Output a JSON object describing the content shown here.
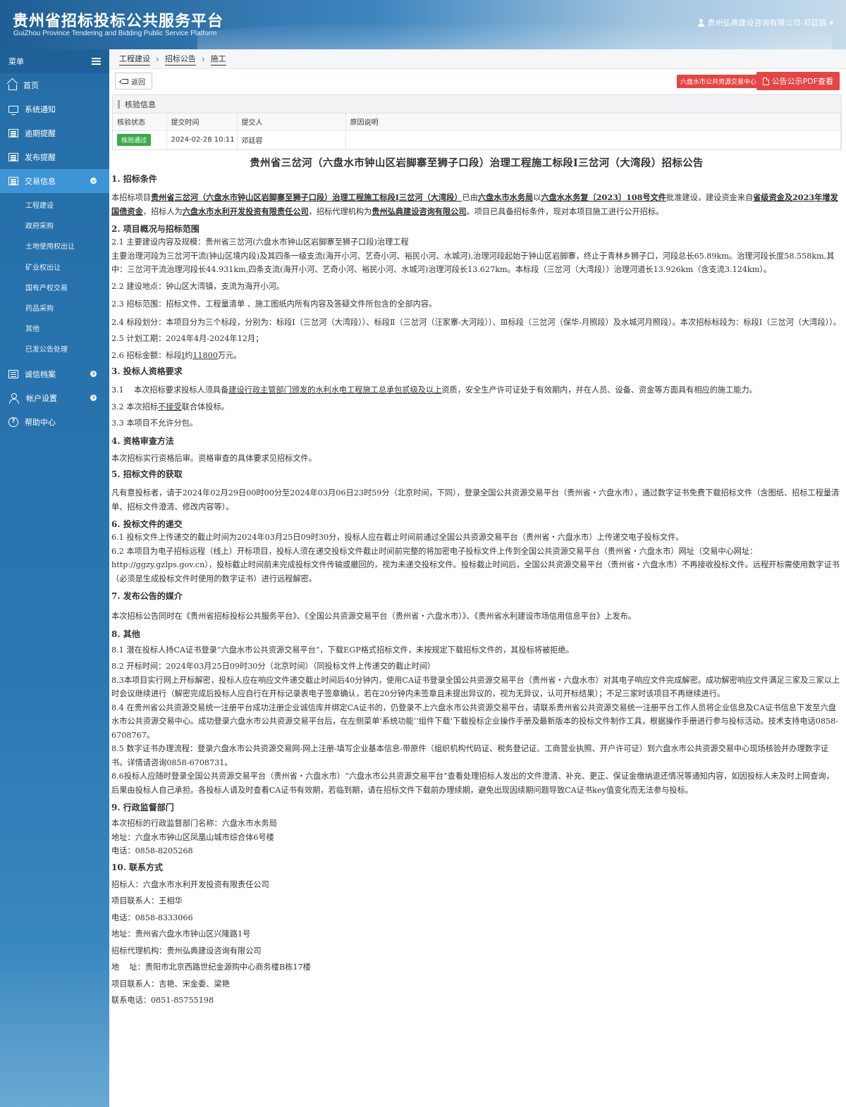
{
  "header": {
    "title": "贵州省招标投标公共服务平台",
    "subtitle": "GuiZhou Province Tendering and Bidding Public Service Platform",
    "user": "贵州弘典建设咨询有限公司-邓廷容",
    "user_caret": "▾"
  },
  "sidebar": {
    "menu_label": "菜单",
    "items": [
      {
        "label": "首页"
      },
      {
        "label": "系统通知"
      },
      {
        "label": "逾期提醒"
      },
      {
        "label": "发布提醒"
      },
      {
        "label": "交易信息"
      },
      {
        "label": "诚信档案"
      },
      {
        "label": "帐户设置"
      },
      {
        "label": "帮助中心"
      }
    ],
    "help_glyph": "?",
    "sub_items": [
      "工程建设",
      "政府采购",
      "土地使用权出让",
      "矿业权出让",
      "国有产权交易",
      "药品采购",
      "其他",
      "已发公告处理"
    ]
  },
  "breadcrumb": {
    "items": [
      "工程建设",
      "招标公告",
      "施工"
    ],
    "sep": "›"
  },
  "toolbar": {
    "back_label": "返回",
    "center_tag": "六盘水市公共资源交易中心",
    "pdf_label": "公告公示PDF查看"
  },
  "verify": {
    "title": "核验信息",
    "headers": [
      "核验状态",
      "提交时间",
      "提交人",
      "原因说明"
    ],
    "status": "核验通过",
    "time": "2024-02-28 10:11",
    "person": "邓廷容",
    "reason": ""
  },
  "article": {
    "title": "贵州省三岔河（六盘水市钟山区岩脚寨至狮子口段）治理工程施工标段Ⅰ三岔河（大湾段）招标公告",
    "s1": "1. 招标条件",
    "s1_p": {
      "t1": "本招标项目",
      "b1": "贵州省三岔河（六盘水市钟山区岩脚寨至狮子口段）治理工程施工标段Ⅰ三岔河（大湾段）",
      "t2": "已由",
      "b2": "六盘水市水务局",
      "t3": "以",
      "b3": "六盘水水务复〔2023〕108号文件",
      "t4": "批准建设，建设资金来自",
      "b4": "省级资金及2023年增发国债资金",
      "t5": "，招标人为",
      "b5": "六盘水市水利开发投资有限责任公司",
      "t6": "，招标代理机构为",
      "b6": "贵州弘典建设咨询有限公司",
      "t7": "。项目已具备招标条件，现对本项目施工进行公开招标。"
    },
    "s2": "2. 项目概况与招标范围",
    "p2_1": "2.1 主要建设内容及规模：贵州省三岔河(六盘水市钟山区岩脚寨至狮子口段)治理工程",
    "p2_1b": "主要治理河段为三岔河干流(钟山区境内段)及其四条一级支流(海开小河、艺奇小河、裕民小河、水城河),治理河段起始于钟山区岩脚寨，终止于青林乡狮子口，河段总长65.89km。治理河段长度58.558km,其中：三岔河干流治理河段长44.931km,四条支流(海开小河、艺奇小河、裕民小河、水城河)治理河段长13.627km。本标段（三岔河（大湾段））治理河道长13.926km（含支流3.124km）。",
    "p2_2": "2.2 建设地点：钟山区大湾镇，支流为海开小河。",
    "p2_3": "2.3 招标范围：招标文件、工程量清单 、施工图纸内所有内容及答疑文件所包含的全部内容。",
    "p2_4": "2.4 标段划分：本项目分为三个标段，分别为：标段Ⅰ（三岔河（大湾段））、标段Ⅱ（三岔河（汪家寨-大河段））、Ⅲ标段（三岔河（保华-月照段）及水城河月照段）。本次招标标段为：标段Ⅰ（三岔河（大湾段））。",
    "p2_5": "2.5 计划工期：2024年4月-2024年12月；",
    "p2_6": {
      "t1": "2.6 招标金额：标段",
      "u1": "Ⅰ",
      "t2": "约",
      "u2": "11800",
      "t3": "万元。"
    },
    "s3": "3. 投标人资格要求",
    "p3_1": {
      "t1": "3.1    本次招标要求投标人须具备",
      "u1": "建设行政主管部门颁发的水利水电工程施工总承包贰级及以上",
      "t2": "资质，安全生产许可证处于有效期内，并在人员、设备、资金等方面具有相应的施工能力。"
    },
    "p3_2": {
      "t1": "3.2 本次招标",
      "u1": "不接受",
      "t2": "联合体投标。"
    },
    "p3_3": "3.3 本项目不允许分包。",
    "s4": "4. 资格审查方法",
    "p4": "本次招标实行资格后审。资格审查的具体要求见招标文件。",
    "s5": "5. 招标文件的获取",
    "p5": "凡有意投标者，请于2024年02月29日00时00分至2024年03月06日23时59分（北京时间，下同），登录全国公共资源交易平台（贵州省・六盘水市），通过数字证书免费下载招标文件（含图纸、招标工程量清单、招标文件澄清、修改内容等）。",
    "s6": "6. 投标文件的递交",
    "p6_1": "6.1 投标文件上传递交的截止时间为2024年03月25日09时30分，投标人应在截止时间前通过全国公共资源交易平台（贵州省・六盘水市）上传递交电子投标文件。",
    "p6_2": "6.2 本项目为电子招标远程（线上）开标项目，投标人须在递交投标文件截止时间前完整的将加密电子投标文件上传到全国公共资源交易平台（贵州省・六盘水市）网址（交易中心网址：http://ggzy.gzlps.gov.cn），投标截止时间前未完成投标文件传输或撤回的，视为未递交投标文件。投标截止时间后，全国公共资源交易平台（贵州省・六盘水市）不再接收投标文件。远程开标需使用数字证书（必须是生成投标文件时使用的数字证书）进行远程解密。",
    "s7": "7. 发布公告的媒介",
    "p7": "本次招标公告同时在《贵州省招标投标公共服务平台》、《全国公共资源交易平台（贵州省・六盘水市）》、《贵州省水利建设市场信用信息平台》上发布。",
    "s8": "8. 其他",
    "p8_1": "8.1 潜在投标人持CA证书登录“六盘水市公共资源交易平台”，下载EGP格式招标文件，未按规定下载招标文件的，其投标将被拒绝。",
    "p8_2": "8.2 开标时间：2024年03月25日09时30分（北京时间）（同投标文件上传递交的截止时间）",
    "p8_3": "8.3本项目实行网上开标解密，投标人应在响应文件递交截止时间后40分钟内，使用CA证书登录全国公共资源交易平台（贵州省・六盘水市）对其电子响应文件完成解密。成功解密响应文件满足三家及三家以上时会议继续进行（解密完成后投标人应自行在开标记录表电子签章确认，若在20分钟内未签章且未提出异议的，视为无异议，认可开标结果）；不足三家时该项目不再继续进行。",
    "p8_4": "8.4 在贵州省公共资源交易统一注册平台成功注册企业诚信库并绑定CA证书的，仍登录不上六盘水市公共资源交易平台，请联系贵州省公共资源交易统一注册平台工作人员将企业信息及CA证书信息下发至六盘水市公共资源交易中心。成功登录六盘水市公共资源交易平台后，在左侧菜单‘系统功能’‘组件下载’下载投标企业操作手册及最新版本的投标文件制作工具，根据操作手册进行参与投标活动。技术支持电话0858-6708767。",
    "p8_5": "8.5 数字证书办理流程：登录六盘水市公共资源交易网-网上注册-填写企业基本信息-带原件（组织机构代码证、税务登记证、工商营业执照、开户许可证）到六盘水市公共资源交易中心现场核验并办理数字证书。详情请咨询0858-6708731。",
    "p8_6": "8.6投标人应随时登录全国公共资源交易平台（贵州省・六盘水市）“六盘水市公共资源交易平台”查看处理招标人发出的文件澄清、补充、更正、保证金缴纳退还情况等通知内容，如因投标人未及时上网查询，后果由投标人自己承担。各投标人请及时查看CA证书有效期，若临到期，请在招标文件下载前办理续期，避免出现因续期问题导致CA证书key值变化而无法参与投标。",
    "s9": "9. 行政监督部门",
    "p9_1": "本次招标的行政监督部门名称：六盘水市水务局",
    "p9_2": "地址：六盘水市钟山区凤凰山城市综合体6号楼",
    "p9_3": "电话：0858-8205268",
    "s10": "10. 联系方式",
    "c1": "招标人：六盘水市水利开发投资有限责任公司",
    "c2": "项目联系人：王相华",
    "c3": "电话：0858-8333066",
    "c4": "地址：贵州省六盘水市钟山区兴隆路1号",
    "c5": "招标代理机构：贵州弘典建设咨询有限公司",
    "c6": "地    址：贵阳市北京西路世纪金源购中心商务楼B栋17楼",
    "c7": "项目联系人：吉艳、宋金委、梁艳",
    "c8": "联系电话：0851-85755198"
  }
}
